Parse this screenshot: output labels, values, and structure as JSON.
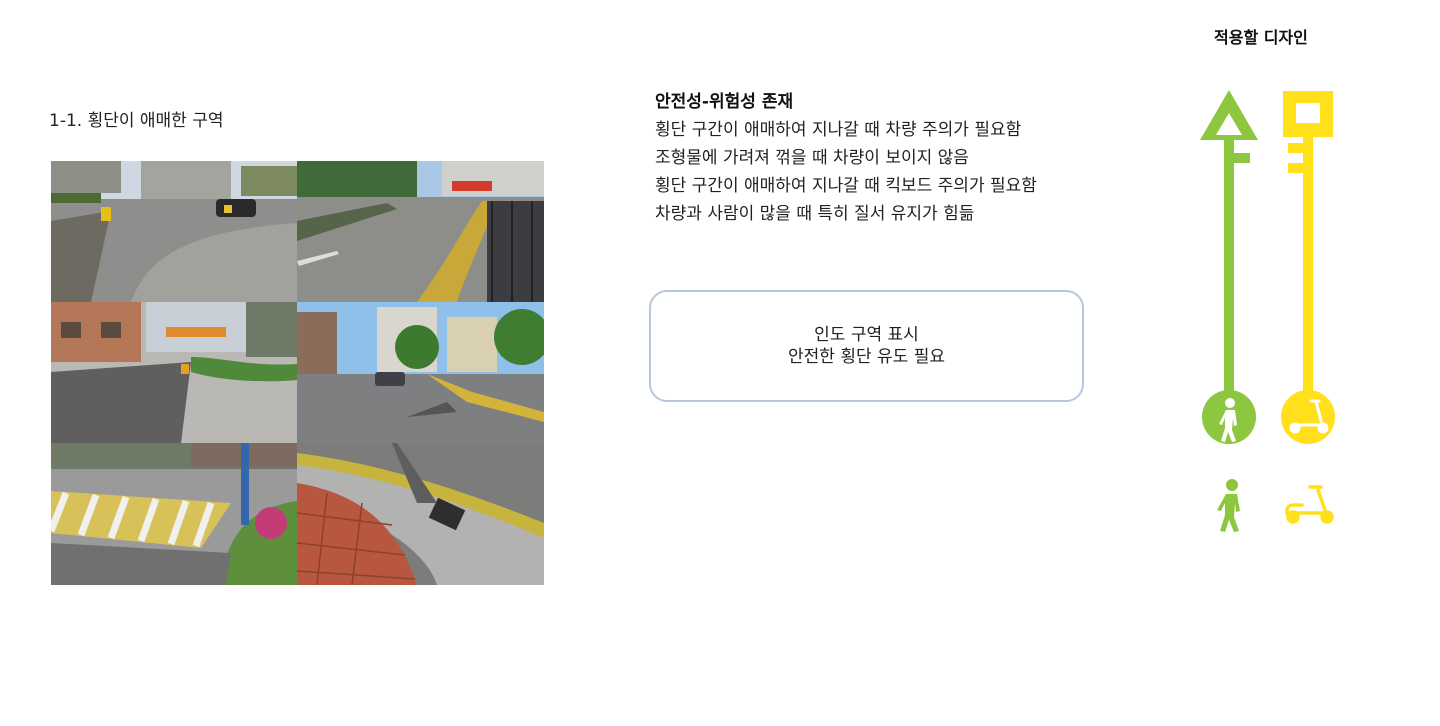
{
  "section": {
    "title": "1-1. 횡단이 애매한 구역"
  },
  "photos": [
    {
      "name": "photo-road-corner-barrier"
    },
    {
      "name": "photo-road-fence-curve"
    },
    {
      "name": "photo-sidewalk-building-shadow"
    },
    {
      "name": "photo-street-buildings-trees"
    },
    {
      "name": "photo-crosswalk-flowerbed"
    },
    {
      "name": "photo-brick-sidewalk-curb"
    }
  ],
  "risk": {
    "heading": "안전성-위험성 존재",
    "lines": [
      "횡단 구간이 애매하여 지나갈 때 차량 주의가 필요함",
      "조형물에 가려져 꺾을 때 차량이 보이지 않음",
      "횡단 구간이 애매하여 지나갈 때 킥보드 주의가 필요함",
      "차량과 사람이 많을 때 특히 질서 유지가 힘듦"
    ]
  },
  "callout": {
    "line1": "인도 구역 표시",
    "line2": "안전한 횡단 유도 필요"
  },
  "design": {
    "title": "적용할 디자인",
    "pedestrian_color": "#8dc63f",
    "scooter_color": "#ffe01a",
    "icons": [
      "pedestrian-icon",
      "kick-scooter-icon"
    ]
  }
}
